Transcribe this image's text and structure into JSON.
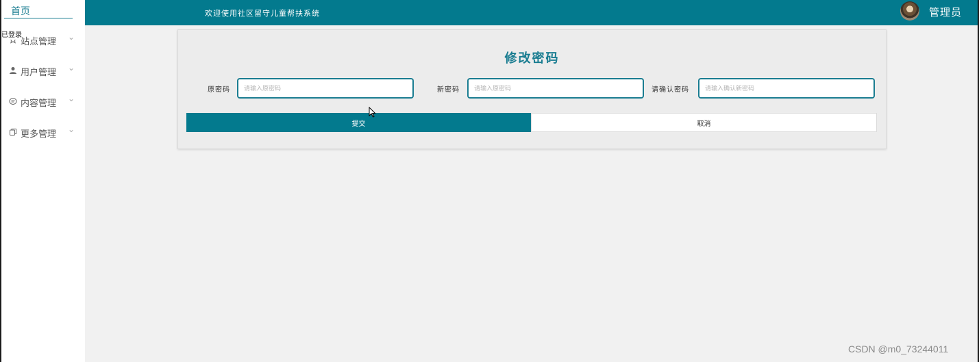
{
  "sidebar": {
    "home_label": "首页",
    "tooltip": "已登录",
    "items": [
      {
        "label": "站点管理",
        "icon": "star-icon"
      },
      {
        "label": "用户管理",
        "icon": "user-icon"
      },
      {
        "label": "内容管理",
        "icon": "chat-icon"
      },
      {
        "label": "更多管理",
        "icon": "copy-icon"
      }
    ]
  },
  "header": {
    "title": "欢迎使用社区留守儿童帮扶系统",
    "role": "管理员",
    "accent_color": "#037a8e"
  },
  "form": {
    "heading": "修改密码",
    "fields": [
      {
        "label": "原密码",
        "placeholder": "请输入原密码"
      },
      {
        "label": "新密码",
        "placeholder": "请输入原密码"
      },
      {
        "label": "请确认密码",
        "placeholder": "请输入确认新密码"
      }
    ],
    "submit_label": "提交",
    "cancel_label": "取消"
  },
  "watermark": "CSDN @m0_73244011"
}
